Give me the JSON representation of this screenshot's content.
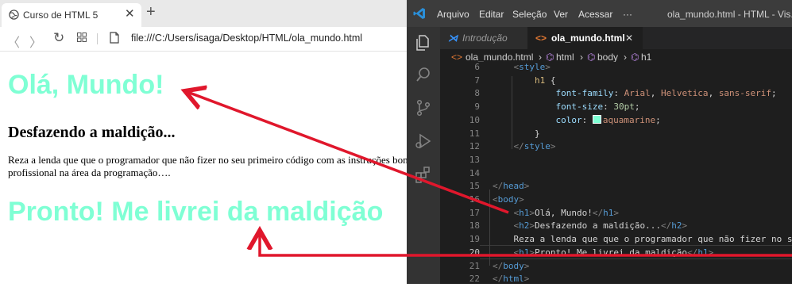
{
  "browser": {
    "tab_title": "Curso de HTML 5",
    "tab_close": "✕",
    "new_tab": "+",
    "back": "〈",
    "forward": "〉",
    "reload": "↻",
    "url": "file:///C:/Users/isaga/Desktop/HTML/ola_mundo.html"
  },
  "page": {
    "h1_first": "Olá, Mundo!",
    "h2": "Desfazendo a maldição...",
    "paragraph": "Reza a lenda que que o programador que não fizer no seu primeiro código com as instruções bom profissional na área da programação….",
    "h1_second": "Pronto! Me livrei da maldição"
  },
  "vscode": {
    "menu": [
      "Arquivo",
      "Editar",
      "Seleção",
      "Ver",
      "Acessar",
      "···"
    ],
    "window_title": "ola_mundo.html - HTML - Vis...",
    "tabs": [
      {
        "icon": "vscode-file-icon",
        "label": "Introdução"
      },
      {
        "icon": "html-file-icon",
        "label": "ola_mundo.html",
        "close": "✕"
      }
    ],
    "breadcrumbs": [
      "ola_mundo.html",
      "html",
      "body",
      "h1"
    ],
    "breadcrumb_sep": "›",
    "lines": [
      {
        "n": "6",
        "parts": [
          {
            "c": "br",
            "t": "    <"
          },
          {
            "c": "tag",
            "t": "style"
          },
          {
            "c": "br",
            "t": ">"
          }
        ]
      },
      {
        "n": "7",
        "parts": [
          {
            "c": "sel",
            "t": "        h1"
          },
          {
            "c": "txt",
            "t": " {"
          }
        ]
      },
      {
        "n": "8",
        "parts": [
          {
            "c": "prop",
            "t": "            font-family"
          },
          {
            "c": "txt",
            "t": ": "
          },
          {
            "c": "str",
            "t": "Arial"
          },
          {
            "c": "txt",
            "t": ", "
          },
          {
            "c": "str",
            "t": "Helvetica"
          },
          {
            "c": "txt",
            "t": ", "
          },
          {
            "c": "str",
            "t": "sans-serif"
          },
          {
            "c": "txt",
            "t": ";"
          }
        ]
      },
      {
        "n": "9",
        "parts": [
          {
            "c": "prop",
            "t": "            font-size"
          },
          {
            "c": "txt",
            "t": ": "
          },
          {
            "c": "num",
            "t": "30pt"
          },
          {
            "c": "txt",
            "t": ";"
          }
        ]
      },
      {
        "n": "10",
        "parts": [
          {
            "c": "prop",
            "t": "            color"
          },
          {
            "c": "txt",
            "t": ": "
          },
          {
            "c": "swatch",
            "t": ""
          },
          {
            "c": "str",
            "t": "aquamarine"
          },
          {
            "c": "txt",
            "t": ";"
          }
        ]
      },
      {
        "n": "11",
        "parts": [
          {
            "c": "txt",
            "t": "        }"
          }
        ]
      },
      {
        "n": "12",
        "parts": [
          {
            "c": "br",
            "t": "    </"
          },
          {
            "c": "tag",
            "t": "style"
          },
          {
            "c": "br",
            "t": ">"
          }
        ]
      },
      {
        "n": "13",
        "parts": []
      },
      {
        "n": "14",
        "parts": []
      },
      {
        "n": "15",
        "parts": [
          {
            "c": "br",
            "t": "</"
          },
          {
            "c": "tag",
            "t": "head"
          },
          {
            "c": "br",
            "t": ">"
          }
        ]
      },
      {
        "n": "16",
        "parts": [
          {
            "c": "br",
            "t": "<"
          },
          {
            "c": "tag",
            "t": "body"
          },
          {
            "c": "br",
            "t": ">"
          }
        ]
      },
      {
        "n": "17",
        "parts": [
          {
            "c": "br",
            "t": "    <"
          },
          {
            "c": "tag",
            "t": "h1"
          },
          {
            "c": "br",
            "t": ">"
          },
          {
            "c": "txt",
            "t": "Olá, Mundo!"
          },
          {
            "c": "br",
            "t": "</"
          },
          {
            "c": "tag",
            "t": "h1"
          },
          {
            "c": "br",
            "t": ">"
          }
        ]
      },
      {
        "n": "18",
        "parts": [
          {
            "c": "br",
            "t": "    <"
          },
          {
            "c": "tag",
            "t": "h2"
          },
          {
            "c": "br",
            "t": ">"
          },
          {
            "c": "txt",
            "t": "Desfazendo a maldição..."
          },
          {
            "c": "br",
            "t": "</"
          },
          {
            "c": "tag",
            "t": "h2"
          },
          {
            "c": "br",
            "t": ">"
          }
        ]
      },
      {
        "n": "19",
        "parts": [
          {
            "c": "txt",
            "t": "    Reza a lenda que que o programador que não fizer no seu"
          }
        ]
      },
      {
        "n": "20",
        "parts": [
          {
            "c": "br",
            "t": "    <"
          },
          {
            "c": "tag",
            "t": "h1"
          },
          {
            "c": "br",
            "t": ">"
          },
          {
            "c": "txt",
            "t": "Pronto! Me livrei da maldição"
          },
          {
            "c": "br",
            "t": "</"
          },
          {
            "c": "tag",
            "t": "h1"
          },
          {
            "c": "br",
            "t": ">"
          }
        ]
      },
      {
        "n": "21",
        "parts": [
          {
            "c": "br",
            "t": "</"
          },
          {
            "c": "tag",
            "t": "body"
          },
          {
            "c": "br",
            "t": ">"
          }
        ]
      },
      {
        "n": "22",
        "parts": [
          {
            "c": "br",
            "t": "</"
          },
          {
            "c": "tag",
            "t": "html"
          },
          {
            "c": "br",
            "t": ">"
          }
        ]
      }
    ],
    "active_line": "20"
  },
  "colors": {
    "heading_aquamarine": "#7fffd4",
    "arrow_red": "#e0172c",
    "editor_bg": "#1e1e1e"
  }
}
